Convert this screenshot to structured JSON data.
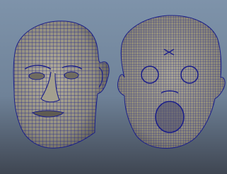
{
  "viewport": {
    "background_top": "#7e93aa",
    "background_bottom": "#3f4652",
    "objects": [
      {
        "name": "head-mesh-shaded-wireframe",
        "surface_color": "#9a9686",
        "wire_color": "#1b1f8a"
      },
      {
        "name": "head-mesh-flattened-wireframe",
        "surface_color": "#9a9686",
        "wire_color": "#1b1f8a"
      }
    ]
  }
}
